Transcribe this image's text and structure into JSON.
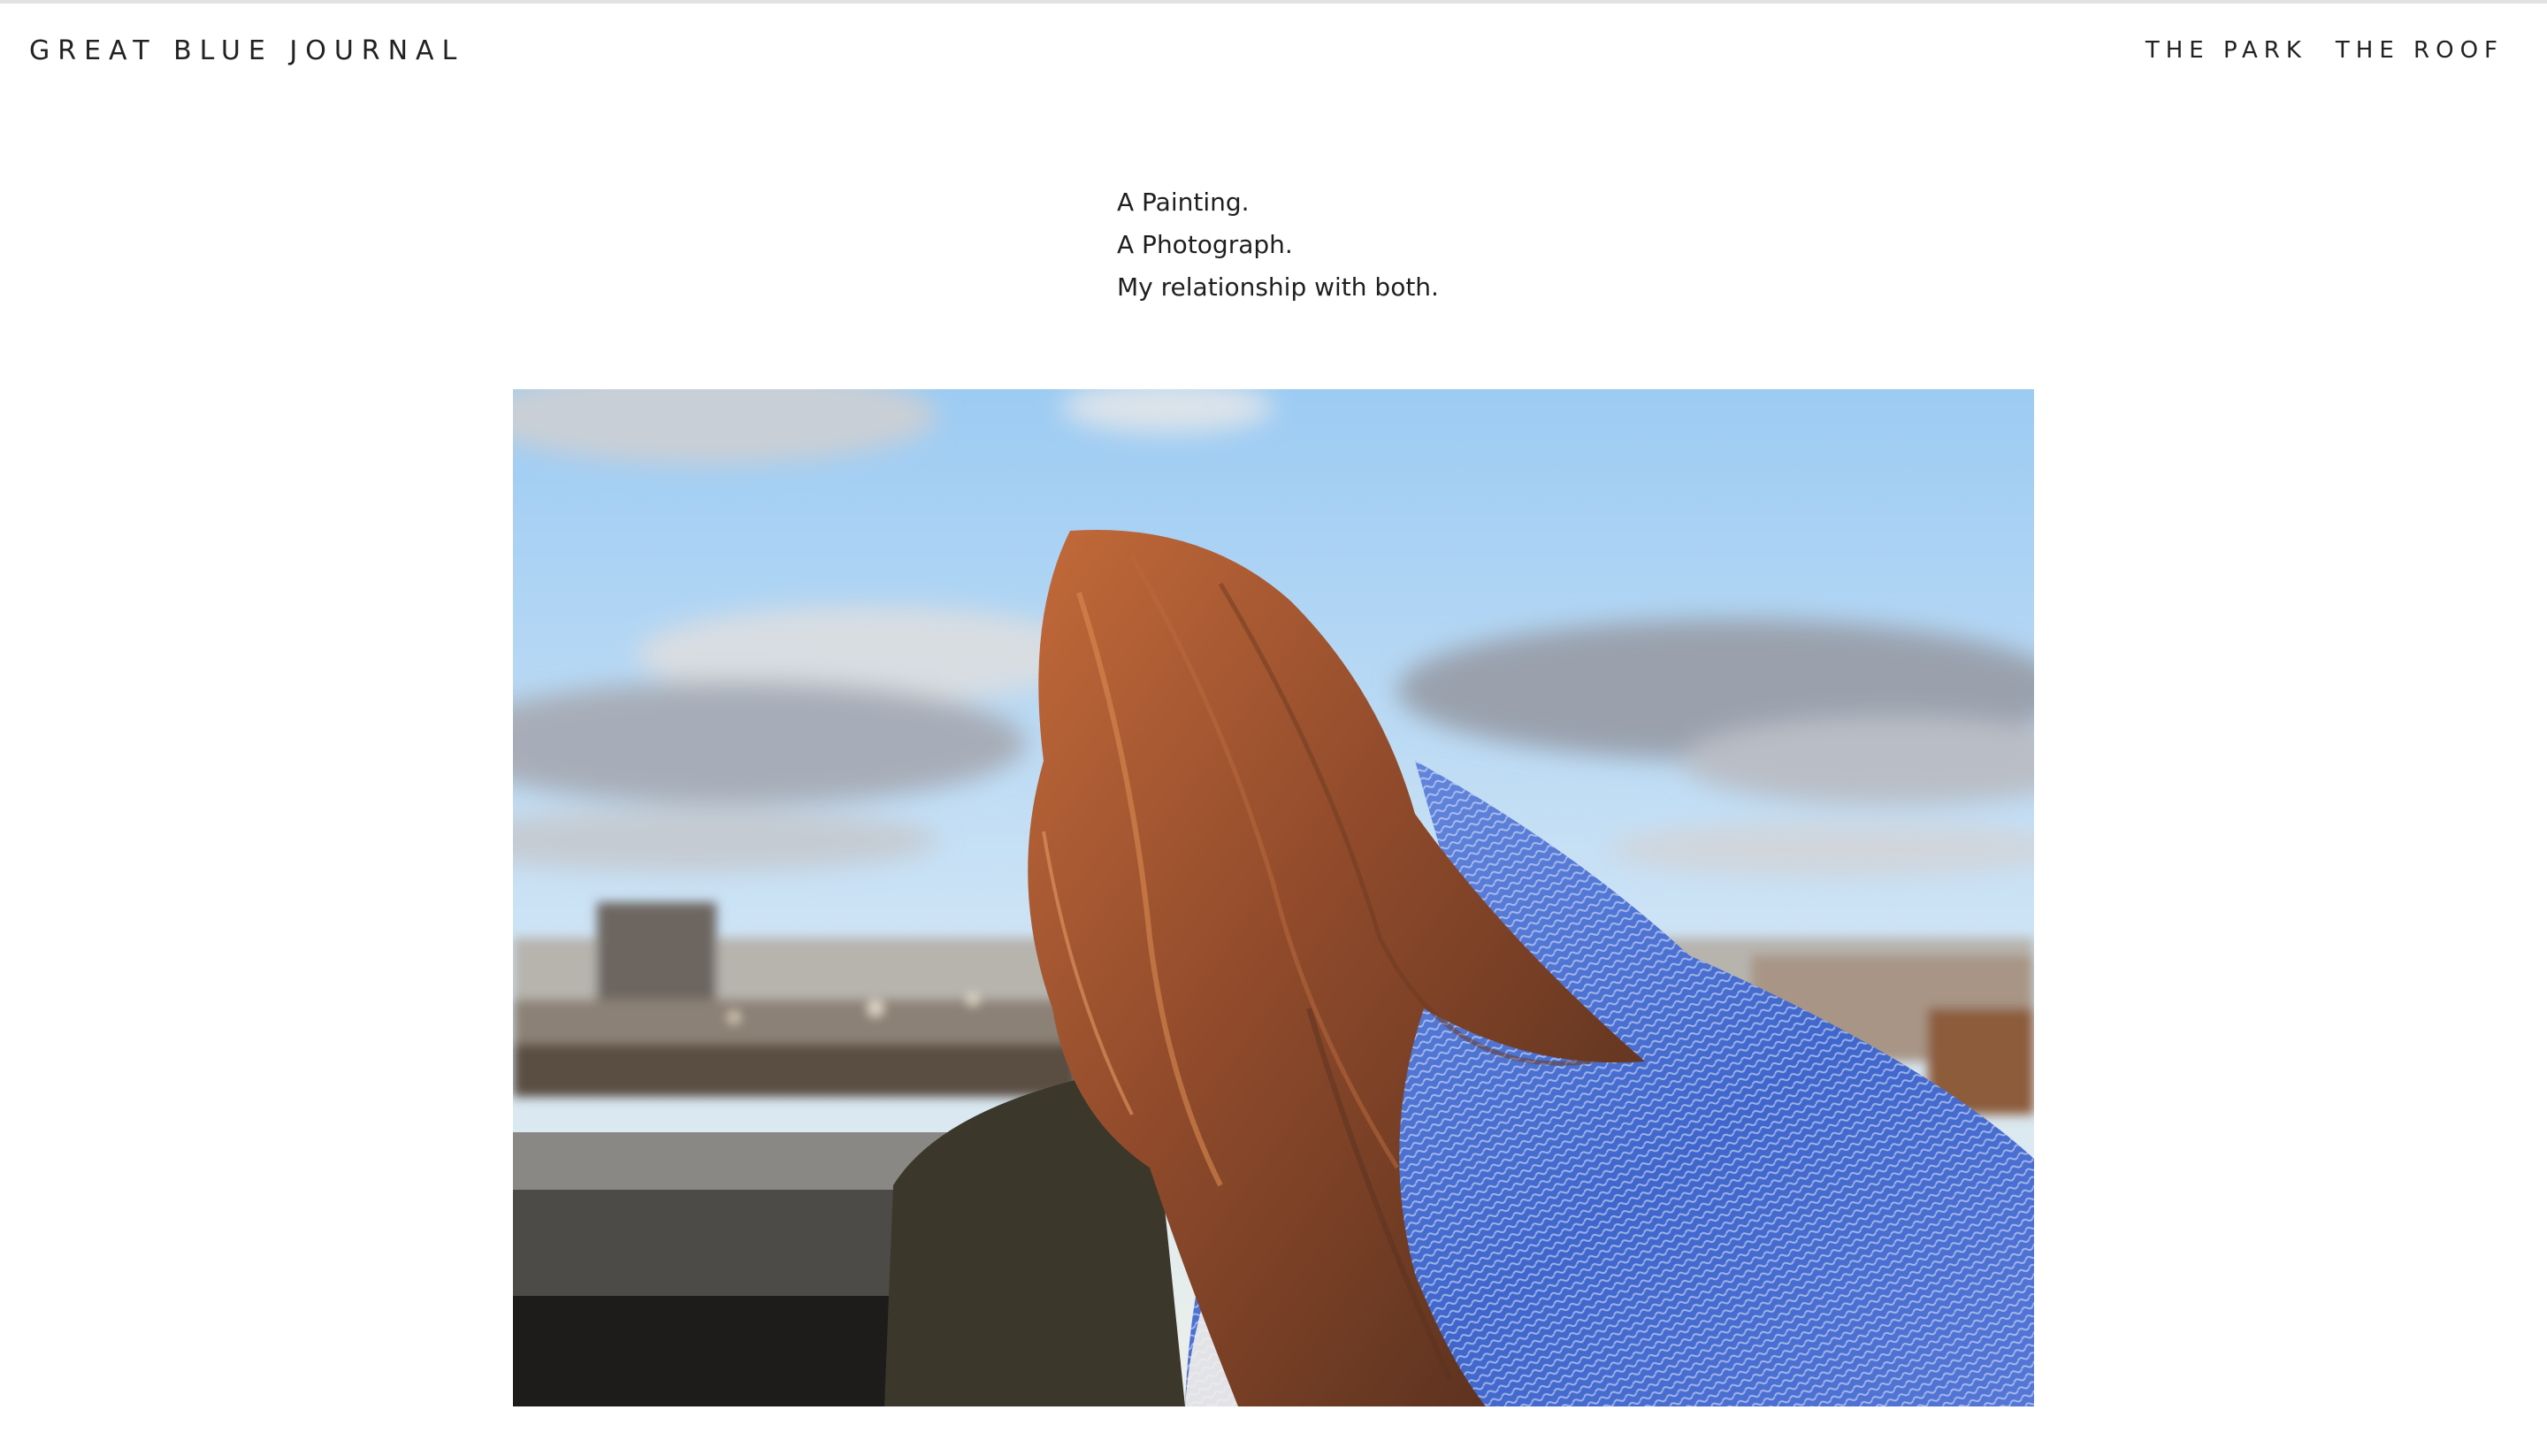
{
  "header": {
    "site_title": "GREAT BLUE JOURNAL",
    "nav": [
      {
        "label": "THE PARK"
      },
      {
        "label": "THE ROOF"
      }
    ]
  },
  "intro": {
    "lines": [
      "A Painting.",
      "A Photograph.",
      "My relationship with both."
    ]
  },
  "photo": {
    "subject": "person with long auburn hair and blue woven blanket on a rooftop overlooking city skyline under cloudy blue sky",
    "colors": {
      "sky_top": "#a9d2f5",
      "sky_bottom": "#e3eef6",
      "cloud": "#aab0bc",
      "hair": "#9a4e2c",
      "blanket": "#4a6fd1",
      "jacket": "#3f3a2c",
      "ledge": "#5f5f5c"
    }
  }
}
